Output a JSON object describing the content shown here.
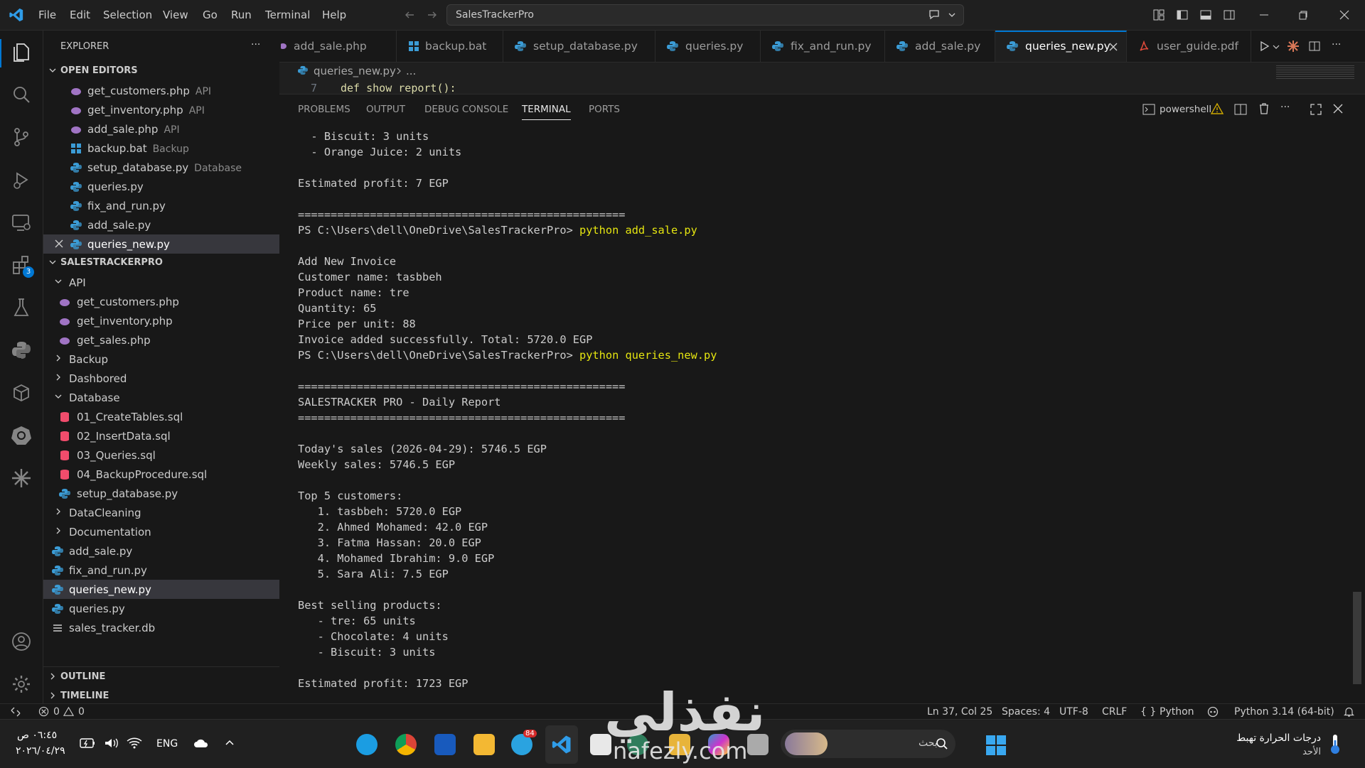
{
  "titlebar": {
    "menu": [
      "File",
      "Edit",
      "Selection",
      "View",
      "Go",
      "Run",
      "Terminal",
      "Help"
    ],
    "search_text": "SalesTrackerPro"
  },
  "explorer": {
    "title": "EXPLORER",
    "more": "···",
    "open_editors_header": "OPEN EDITORS",
    "open_editors": [
      {
        "name": "get_customers.php",
        "desc": "API",
        "icon": "php-icon"
      },
      {
        "name": "get_inventory.php",
        "desc": "API",
        "icon": "php-icon"
      },
      {
        "name": "add_sale.php",
        "desc": "API",
        "icon": "php-icon"
      },
      {
        "name": "backup.bat",
        "desc": "Backup",
        "icon": "bat-icon"
      },
      {
        "name": "setup_database.py",
        "desc": "Database",
        "icon": "python-icon"
      },
      {
        "name": "queries.py",
        "desc": "",
        "icon": "python-icon"
      },
      {
        "name": "fix_and_run.py",
        "desc": "",
        "icon": "python-icon"
      },
      {
        "name": "add_sale.py",
        "desc": "",
        "icon": "python-icon"
      },
      {
        "name": "queries_new.py",
        "desc": "",
        "icon": "python-icon"
      }
    ],
    "project_header": "SALESTRACKERPRO",
    "tree": {
      "api": "API",
      "api_files": [
        "get_customers.php",
        "get_inventory.php",
        "get_sales.php"
      ],
      "backup": "Backup",
      "dashbored": "Dashbored",
      "database": "Database",
      "db_files": [
        "01_CreateTables.sql",
        "02_InsertData.sql",
        "03_Queries.sql",
        "04_BackupProcedure.sql",
        "setup_database.py"
      ],
      "datacleaning": "DataCleaning",
      "documentation": "Documentation",
      "root_files": [
        "add_sale.py",
        "fix_and_run.py",
        "queries_new.py",
        "queries.py",
        "sales_tracker.db"
      ]
    },
    "outline": "OUTLINE",
    "timeline": "TIMELINE"
  },
  "tabs": [
    {
      "label": "add_sale.php"
    },
    {
      "label": "backup.bat"
    },
    {
      "label": "setup_database.py"
    },
    {
      "label": "queries.py"
    },
    {
      "label": "fix_and_run.py"
    },
    {
      "label": "add_sale.py"
    },
    {
      "label": "queries_new.py"
    },
    {
      "label": "user_guide.pdf"
    }
  ],
  "breadcrumb": {
    "file": "queries_new.py",
    "rest": "..."
  },
  "editor": {
    "line_no": "7",
    "code": "def show_report():"
  },
  "panel": {
    "tabs": [
      "PROBLEMS",
      "OUTPUT",
      "DEBUG CONSOLE",
      "TERMINAL",
      "PORTS"
    ],
    "shell": "powershell"
  },
  "terminal": {
    "lines": [
      "  - Biscuit: 3 units",
      "  - Orange Juice: 2 units",
      "",
      "Estimated profit: 7 EGP",
      "",
      "==================================================",
      "PS C:\\Users\\dell\\OneDrive\\SalesTrackerPro> ",
      "",
      "Add New Invoice",
      "Customer name: tasbbeh",
      "Product name: tre",
      "Quantity: 65",
      "Price per unit: 88",
      "Invoice added successfully. Total: 5720.0 EGP",
      "PS C:\\Users\\dell\\OneDrive\\SalesTrackerPro> ",
      "",
      "==================================================",
      "SALESTRACKER PRO - Daily Report",
      "==================================================",
      "",
      "Today's sales (2026-04-29): 5746.5 EGP",
      "Weekly sales: 5746.5 EGP",
      "",
      "Top 5 customers:",
      "   1. tasbbeh: 5720.0 EGP",
      "   2. Ahmed Mohamed: 42.0 EGP",
      "   3. Fatma Hassan: 20.0 EGP",
      "   4. Mohamed Ibrahim: 9.0 EGP",
      "   5. Sara Ali: 7.5 EGP",
      "",
      "Best selling products:",
      "   - tre: 65 units",
      "   - Chocolate: 4 units",
      "   - Biscuit: 3 units",
      "",
      "Estimated profit: 1723 EGP"
    ],
    "cmd1": "python add_sale.py",
    "cmd2": "python queries_new.py"
  },
  "statusbar": {
    "errors": "0",
    "warnings": "0",
    "position": "Ln 37, Col 25",
    "spaces": "Spaces: 4",
    "encoding": "UTF-8",
    "eol": "CRLF",
    "language": "Python",
    "interpreter": "Python 3.14 (64-bit)"
  },
  "taskbar": {
    "time": "٠٦:٤٥ ص",
    "date": "٢٠٢٦/٠٤/٢٩",
    "lang": "ENG",
    "search_placeholder": "بحث",
    "weather_line1": "درجات الحرارة تهبط",
    "weather_line2": "الأحد",
    "telegram_badge": "84"
  },
  "watermark": {
    "brand": "نفذلي",
    "domain": "nafezly.com"
  },
  "colors": {
    "accent": "#0078d4",
    "terminal_cmd": "#e5e510",
    "php": "#a074c4",
    "python": "#3b9cd6",
    "sql": "#f14c6c",
    "pdf": "#e14b3b"
  }
}
